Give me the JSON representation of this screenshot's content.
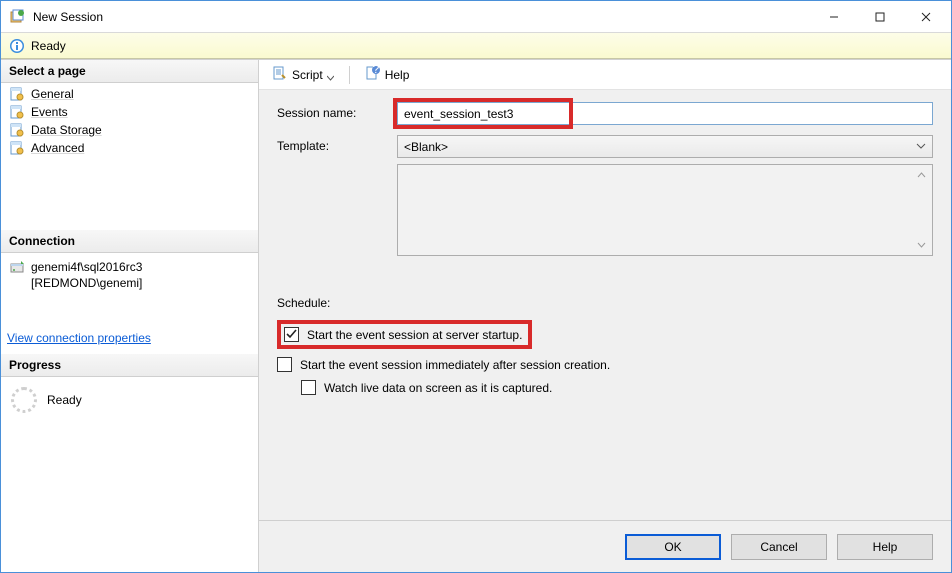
{
  "window": {
    "title": "New Session"
  },
  "ready_bar": {
    "text": "Ready"
  },
  "sidebar": {
    "select_header": "Select a page",
    "pages": [
      {
        "label": "General"
      },
      {
        "label": "Events"
      },
      {
        "label": "Data Storage"
      },
      {
        "label": "Advanced"
      }
    ],
    "connection_header": "Connection",
    "connection": {
      "server": "genemi4f\\sql2016rc3",
      "user": "[REDMOND\\genemi]"
    },
    "view_conn_link": "View connection properties",
    "progress_header": "Progress",
    "progress_label": "Ready"
  },
  "toolbar": {
    "script_label": "Script",
    "help_label": "Help"
  },
  "form": {
    "session_name_label": "Session name:",
    "session_name_value": "event_session_test3",
    "template_label": "Template:",
    "template_value": "<Blank>",
    "schedule_label": "Schedule:",
    "opt_start_server": "Start the event session at server startup.",
    "opt_start_immediate": "Start the event session immediately after session creation.",
    "opt_watch_live": "Watch live data on screen as it is captured."
  },
  "footer": {
    "ok": "OK",
    "cancel": "Cancel",
    "help": "Help"
  }
}
